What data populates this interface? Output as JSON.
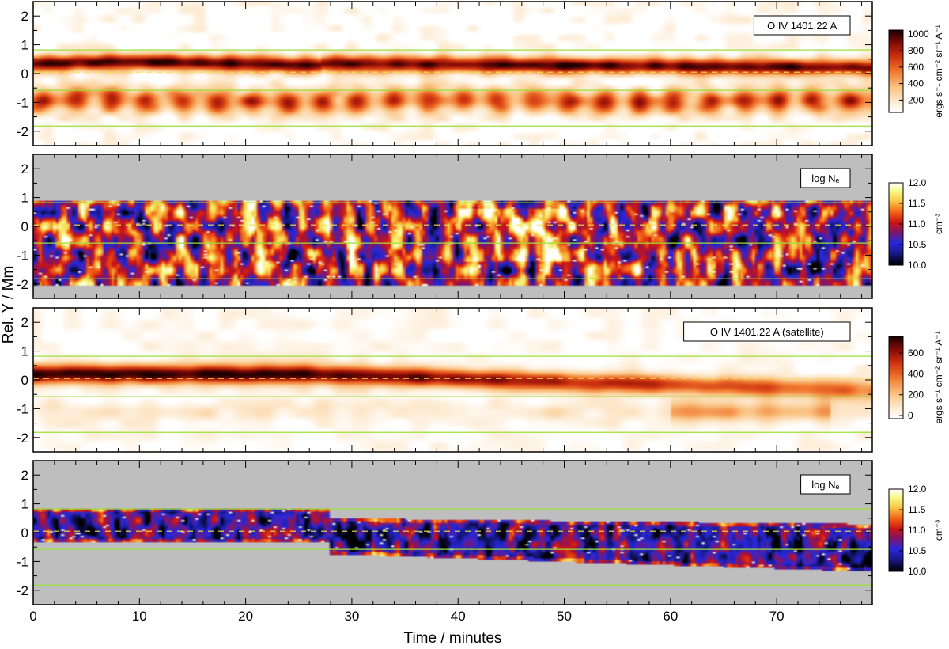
{
  "chart_data": {
    "type": "heatmap",
    "xlabel": "Time / minutes",
    "ylabel": "Rel. Y / Mm",
    "xlim": [
      0,
      79
    ],
    "ylim": [
      -2.5,
      2.5
    ],
    "x_ticks": [
      0,
      10,
      20,
      30,
      40,
      50,
      60,
      70
    ],
    "y_ticks": [
      -2,
      -1,
      0,
      1,
      2
    ],
    "reference_lines": {
      "dashed_yellow_y": [
        0.05
      ],
      "solid_green_y": [
        0.82,
        -0.58,
        -1.82
      ]
    },
    "panels": [
      {
        "id": "intensity-1",
        "label": "O IV 1401.22 A",
        "colormap": "heat",
        "colorbar": {
          "ticks": [
            "200",
            "400",
            "600",
            "800",
            "1000"
          ],
          "tick_values": [
            200,
            400,
            600,
            800,
            1000
          ],
          "range": [
            50,
            1050
          ],
          "unit": "ergs s⁻¹ cm⁻² sr⁻¹ A⁻¹"
        }
      },
      {
        "id": "density-1",
        "label": "log Nₑ",
        "colormap": "density",
        "colorbar": {
          "ticks": [
            "10.0",
            "10.5",
            "11.0",
            "11.5",
            "12.0"
          ],
          "tick_values": [
            10.0,
            10.5,
            11.0,
            11.5,
            12.0
          ],
          "range": [
            10.0,
            12.0
          ],
          "unit": "cm⁻³"
        }
      },
      {
        "id": "intensity-2",
        "label": "O IV 1401.22 A (satellite)",
        "colormap": "heat",
        "colorbar": {
          "ticks": [
            "0",
            "200",
            "400",
            "600"
          ],
          "tick_values": [
            0,
            200,
            400,
            600
          ],
          "range": [
            -30,
            760
          ],
          "unit": "ergs s⁻¹ cm⁻² sr⁻¹ A⁻¹"
        }
      },
      {
        "id": "density-2",
        "label": "log Nₑ",
        "colormap": "density",
        "colorbar": {
          "ticks": [
            "10.0",
            "10.5",
            "11.0",
            "11.5",
            "12.0"
          ],
          "tick_values": [
            10.0,
            10.5,
            11.0,
            11.5,
            12.0
          ],
          "range": [
            10.0,
            12.0
          ],
          "unit": "cm⁻³"
        }
      }
    ]
  }
}
